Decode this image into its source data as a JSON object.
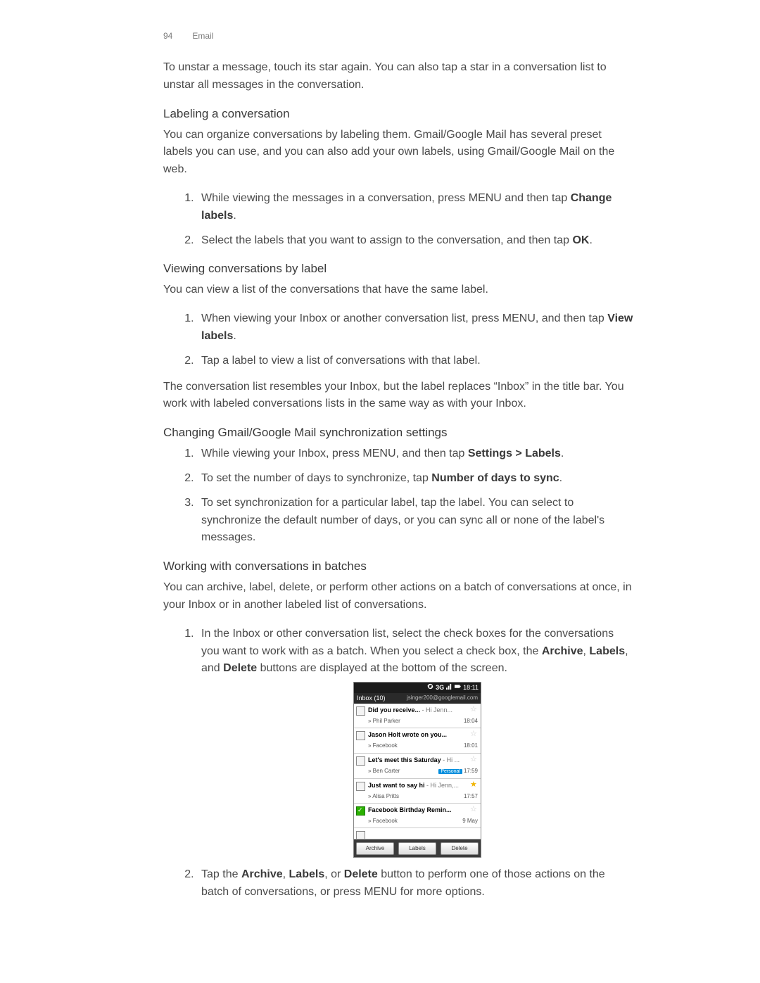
{
  "header": {
    "page_number": "94",
    "section": "Email"
  },
  "intro_para": "To unstar a message, touch its star again. You can also tap a star in a conversation list to unstar all messages in the conversation.",
  "labeling": {
    "heading": "Labeling a conversation",
    "para": "You can organize conversations by labeling them. Gmail/Google Mail has several preset labels you can use, and you can also add your own labels, using Gmail/Google Mail on the web.",
    "step1_a": "While viewing the messages in a conversation, press MENU and then tap ",
    "step1_b": "Change labels",
    "step1_c": ".",
    "step2_a": "Select the labels that you want to assign to the conversation, and then tap ",
    "step2_b": "OK",
    "step2_c": "."
  },
  "viewing": {
    "heading": "Viewing conversations by label",
    "para": "You can view a list of the conversations that have the same label.",
    "step1_a": "When viewing your Inbox or another conversation list, press MENU, and then tap ",
    "step1_b": "View labels",
    "step1_c": ".",
    "step2": "Tap a label to view a list of conversations with that label.",
    "after": "The conversation list resembles your Inbox, but the label replaces “Inbox” in the title bar. You work with labeled conversations lists in the same way as with your Inbox."
  },
  "changing": {
    "heading": "Changing Gmail/Google Mail synchronization settings",
    "step1_a": "While viewing your Inbox, press MENU, and then tap ",
    "step1_b": "Settings > Labels",
    "step1_c": ".",
    "step2_a": "To set the number of days to synchronize, tap ",
    "step2_b": "Number of days to sync",
    "step2_c": ".",
    "step3": "To set synchronization for a particular label, tap the label. You can select to synchronize the default number of days, or you can sync all or none of the label's messages."
  },
  "working": {
    "heading": "Working with conversations in batches",
    "para": "You can archive, label, delete, or perform other actions on a batch of conversations at once, in your Inbox or in another labeled list of conversations.",
    "step1_a": "In the Inbox or other conversation list, select the check boxes for the conversations you want to work with as a batch. When you select a check box, the ",
    "step1_b": "Archive",
    "step1_c": ", ",
    "step1_d": "Labels",
    "step1_e": ", and ",
    "step1_f": "Delete",
    "step1_g": " buttons are displayed at the bottom of the screen.",
    "step2_a": "Tap the ",
    "step2_b": "Archive",
    "step2_c": ", ",
    "step2_d": "Labels",
    "step2_e": ", or ",
    "step2_f": "Delete",
    "step2_g": " button to perform one of those actions on the batch of conversations, or press MENU for more options."
  },
  "phone": {
    "status": {
      "g3": "3G",
      "time": "18:11"
    },
    "titlebar": {
      "left": "Inbox (10)",
      "right": "jsinger200@googlemail.com"
    },
    "rows": [
      {
        "subject_bold": "Did you receive...",
        "subject_gray": " - Hi Jenn...",
        "sender": "» Phil Parker",
        "time": "18:04",
        "starred": false,
        "checked": false,
        "tag": ""
      },
      {
        "subject_bold": "Jason Holt wrote on you...",
        "subject_gray": "",
        "sender": "» Facebook",
        "time": "18:01",
        "starred": false,
        "checked": false,
        "tag": ""
      },
      {
        "subject_bold": "Let's meet this Saturday",
        "subject_gray": " - Hi ...",
        "sender": "» Ben Carter",
        "time": "17:59",
        "starred": false,
        "checked": false,
        "tag": "Personal"
      },
      {
        "subject_bold": "Just want to say hi",
        "subject_gray": " - Hi Jenn,...",
        "sender": "» Alisa Pritts",
        "time": "17:57",
        "starred": true,
        "checked": false,
        "tag": ""
      },
      {
        "subject_bold": "Facebook Birthday Remin...",
        "subject_gray": "",
        "sender": "» Facebook",
        "time": "9 May",
        "starred": false,
        "checked": true,
        "tag": ""
      }
    ],
    "buttons": {
      "archive": "Archive",
      "labels": "Labels",
      "delete": "Delete"
    }
  }
}
